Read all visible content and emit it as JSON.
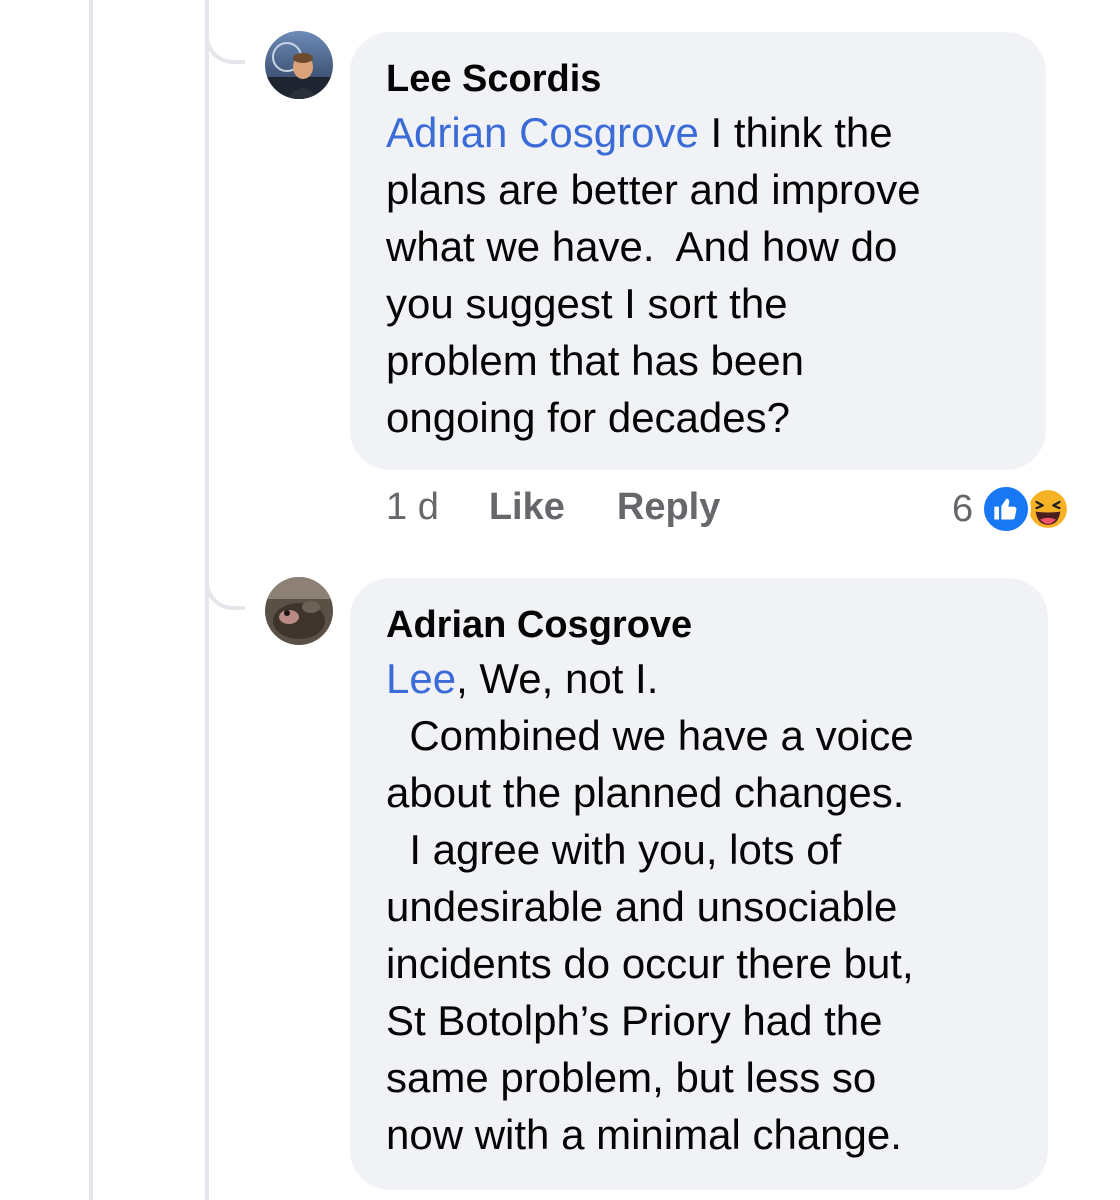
{
  "comments": [
    {
      "author": "Lee Scordis",
      "mention": "Adrian Cosgrove",
      "lines": [
        " I think the",
        "plans are better and improve",
        "what we have.  And how do",
        "you suggest I sort the",
        "problem that has been",
        "ongoing for decades?"
      ],
      "time": "1 d",
      "like_label": "Like",
      "reply_label": "Reply",
      "reaction_count": "6",
      "reactions": [
        "like-icon",
        "haha-icon"
      ]
    },
    {
      "author": "Adrian Cosgrove",
      "mention": "Lee",
      "lines": [
        ", We, not I.",
        "  Combined we have a voice",
        "about the planned changes.",
        "  I agree with you, lots of",
        "undesirable and unsociable",
        "incidents do occur there but,",
        "St Botolph’s Priory had the",
        "same problem, but less so",
        "now with a minimal change."
      ]
    }
  ],
  "colors": {
    "bubble": "#f0f2f5",
    "mention": "#3b6bd6",
    "meta": "#65676b",
    "like_blue": "#1877f2",
    "haha_yellow": "#f7b125"
  }
}
